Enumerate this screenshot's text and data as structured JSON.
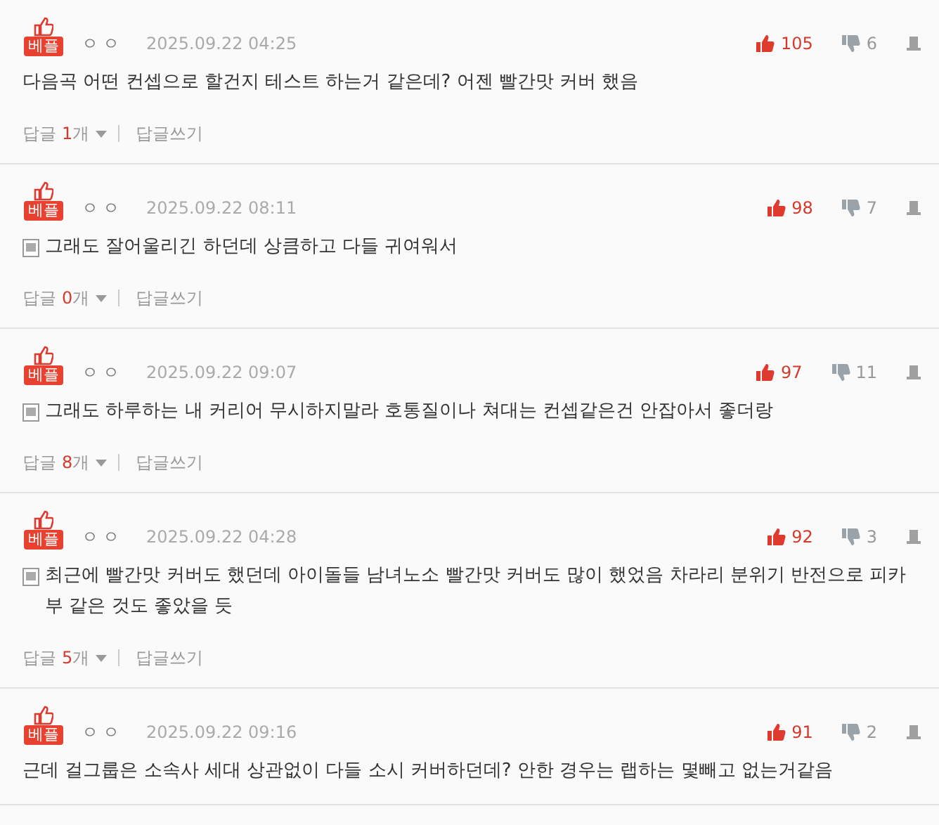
{
  "comments": [
    {
      "badge": "베플",
      "author": "ㅇㅇ",
      "date": "2025.09.22 04:25",
      "likes": "105",
      "dislikes": "6",
      "attachment": false,
      "text": "다음곡 어떤 컨셉으로 할건지 테스트 하는거 같은데? 어젠 빨간맛 커버 했음",
      "reply": {
        "label": "답글",
        "count": "1",
        "unit": "개",
        "write": "답글쓰기"
      }
    },
    {
      "badge": "베플",
      "author": "ㅇㅇ",
      "date": "2025.09.22 08:11",
      "likes": "98",
      "dislikes": "7",
      "attachment": true,
      "text": "그래도 잘어울리긴 하던데 상큼하고 다들 귀여워서",
      "reply": {
        "label": "답글",
        "count": "0",
        "unit": "개",
        "write": "답글쓰기"
      }
    },
    {
      "badge": "베플",
      "author": "ㅇㅇ",
      "date": "2025.09.22 09:07",
      "likes": "97",
      "dislikes": "11",
      "attachment": true,
      "text": "그래도 하루하는 내 커리어 무시하지말라 호통질이나 쳐대는 컨셉같은건 안잡아서 좋더랑",
      "reply": {
        "label": "답글",
        "count": "8",
        "unit": "개",
        "write": "답글쓰기"
      }
    },
    {
      "badge": "베플",
      "author": "ㅇㅇ",
      "date": "2025.09.22 04:28",
      "likes": "92",
      "dislikes": "3",
      "attachment": true,
      "text": "최근에 빨간맛 커버도 했던데 아이돌들 남녀노소 빨간맛 커버도 많이 했었음 차라리 분위기 반전으로 피카부 같은 것도 좋았을 듯",
      "reply": {
        "label": "답글",
        "count": "5",
        "unit": "개",
        "write": "답글쓰기"
      }
    },
    {
      "badge": "베플",
      "author": "ㅇㅇ",
      "date": "2025.09.22 09:16",
      "likes": "91",
      "dislikes": "2",
      "attachment": false,
      "text": "근데 걸그룹은 소속사 세대 상관없이 다들 소시 커버하던데? 안한 경우는 랩하는 몇빼고 없는거같음"
    }
  ]
}
